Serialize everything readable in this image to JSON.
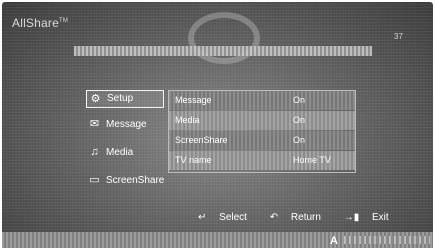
{
  "app": {
    "title": "AllShare",
    "trademark": "TM",
    "corner_number": "37"
  },
  "sidebar": {
    "items": [
      {
        "label": "Setup",
        "icon": "gear-icon",
        "selected": true
      },
      {
        "label": "Message",
        "icon": "envelope-icon",
        "selected": false
      },
      {
        "label": "Media",
        "icon": "music-note-icon",
        "selected": false
      },
      {
        "label": "ScreenShare",
        "icon": "screen-icon",
        "selected": false
      }
    ]
  },
  "settings": {
    "rows": [
      {
        "label": "Message",
        "value": "On"
      },
      {
        "label": "Media",
        "value": "On"
      },
      {
        "label": "ScreenShare",
        "value": "On"
      },
      {
        "label": "TV name",
        "value": "Home TV"
      }
    ]
  },
  "footer": {
    "select_label": "Select",
    "return_label": "Return",
    "exit_label": "Exit",
    "select_symbol": "↵",
    "return_symbol": "↶",
    "exit_symbol": "→▮"
  },
  "bottom": {
    "a_button": "A"
  }
}
